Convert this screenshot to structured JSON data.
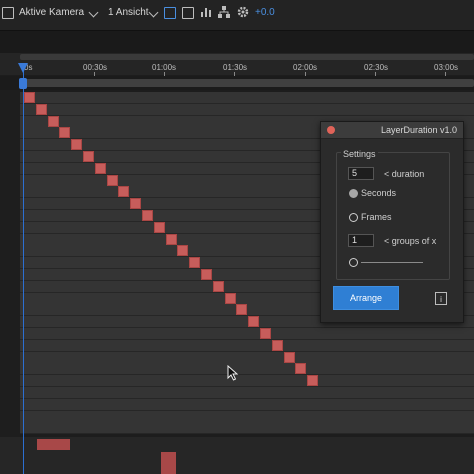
{
  "toolbar": {
    "camera_select": "Aktive Kamera",
    "view_select": "1 Ansicht",
    "exposure_value": "+0.0",
    "icons": [
      "grid-icon",
      "camera-dropdown-chevron-icon",
      "view-dropdown-chevron-icon",
      "fit-icon",
      "fast-preview-icon",
      "histogram-icon",
      "flowchart-icon",
      "gear-icon"
    ]
  },
  "timeline": {
    "ruler_labels": [
      "0s",
      "00:30s",
      "01:00s",
      "01:30s",
      "02:00s",
      "02:30s",
      "03:00s"
    ],
    "layer_count": 25
  },
  "panel": {
    "title": "LayerDuration v1.0",
    "group_label": "Settings",
    "duration_value": "5",
    "duration_label": "< duration",
    "radio_seconds": "Seconds",
    "radio_frames": "Frames",
    "selected_unit": "Seconds",
    "groups_value": "1",
    "groups_label": "< groups of x",
    "arrange_button": "Arrange",
    "info_button": "i"
  },
  "colors": {
    "layer_block": "#c75d5b",
    "playhead": "#3a7ad8",
    "arrange_button": "#2f7fd4",
    "close_button": "#e06359"
  }
}
